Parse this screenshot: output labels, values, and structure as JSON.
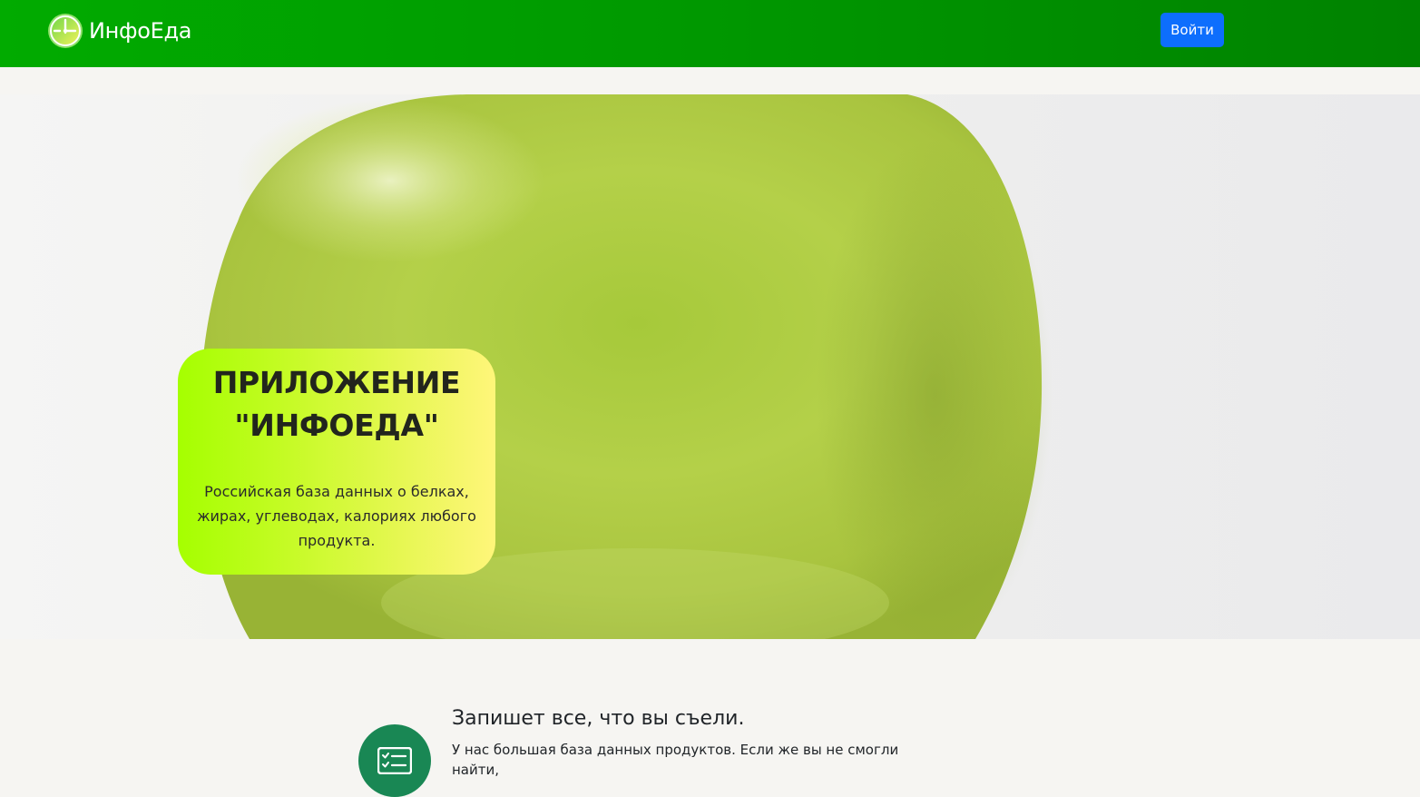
{
  "header": {
    "brand_name": "ИнфоЕда",
    "logo_icon": "clock-leaf-logo-icon",
    "login_label": "Войти",
    "background_colors": [
      "#01ab00",
      "#008200"
    ],
    "button_color": "#0d6efd"
  },
  "hero": {
    "image": "green-apple-photo",
    "title_line1": "ПРИЛОЖЕНИЕ",
    "title_line2": "\"ИНФОЕДА\"",
    "subtitle": "Российская база данных о белках, жирах, углеводах, калориях любого продукта.",
    "card_gradient": [
      "#a5ff00",
      "#fff67a"
    ]
  },
  "features": [
    {
      "icon": "checklist-icon",
      "title": "Запишет все, что вы съели.",
      "text": "У нас большая база данных продуктов. Если же вы не смогли найти,"
    }
  ]
}
